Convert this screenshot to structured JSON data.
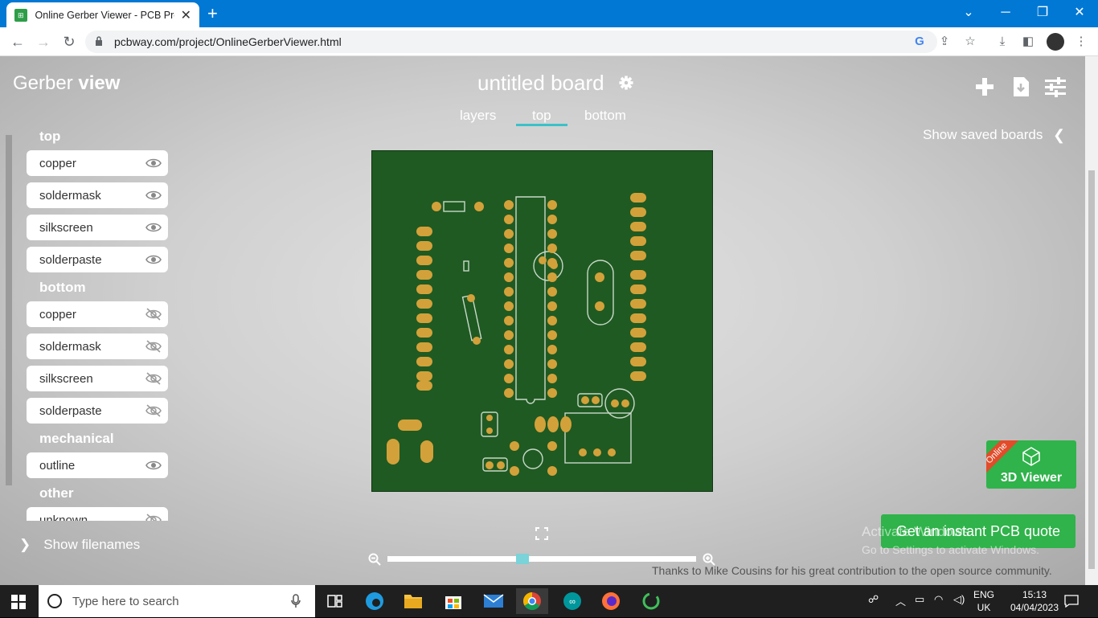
{
  "browser": {
    "tab_title": "Online Gerber Viewer - PCB Proto",
    "url": "pcbway.com/project/OnlineGerberViewer.html"
  },
  "app": {
    "brand_light": "Gerber ",
    "brand_bold": "view",
    "board_title": "untitled board",
    "view_tabs": [
      "layers",
      "top",
      "bottom"
    ],
    "active_view_tab": "top",
    "show_saved": "Show saved boards",
    "show_filenames": "Show filenames",
    "layer_sections": {
      "top": "top",
      "bottom": "bottom",
      "mechanical": "mechanical",
      "other": "other"
    },
    "layers": {
      "top": [
        {
          "name": "copper",
          "visible": true
        },
        {
          "name": "soldermask",
          "visible": true
        },
        {
          "name": "silkscreen",
          "visible": true
        },
        {
          "name": "solderpaste",
          "visible": true
        }
      ],
      "bottom": [
        {
          "name": "copper",
          "visible": false
        },
        {
          "name": "soldermask",
          "visible": false
        },
        {
          "name": "silkscreen",
          "visible": false
        },
        {
          "name": "solderpaste",
          "visible": false
        }
      ],
      "mechanical": [
        {
          "name": "outline",
          "visible": true
        }
      ],
      "other": [
        {
          "name": "unknown",
          "visible": false
        }
      ]
    },
    "zoom_level": 0.44,
    "viewer3d_badge": "Online",
    "viewer3d_label": "3D Viewer",
    "quote_button": "Get an instant PCB quote",
    "thanks": "Thanks to Mike Cousins for his great contribution to the open source community."
  },
  "windows": {
    "activate_title": "Activate Windows",
    "activate_sub": "Go to Settings to activate Windows.",
    "search_placeholder": "Type here to search",
    "lang_top": "ENG",
    "lang_bottom": "UK",
    "time": "15:13",
    "date": "04/04/2023"
  },
  "colors": {
    "tab_bar": "#0078d4",
    "board": "#1f5a22",
    "pad": "#d3a13a",
    "accent": "#3cc1c7",
    "green_button": "#2fb34a"
  }
}
